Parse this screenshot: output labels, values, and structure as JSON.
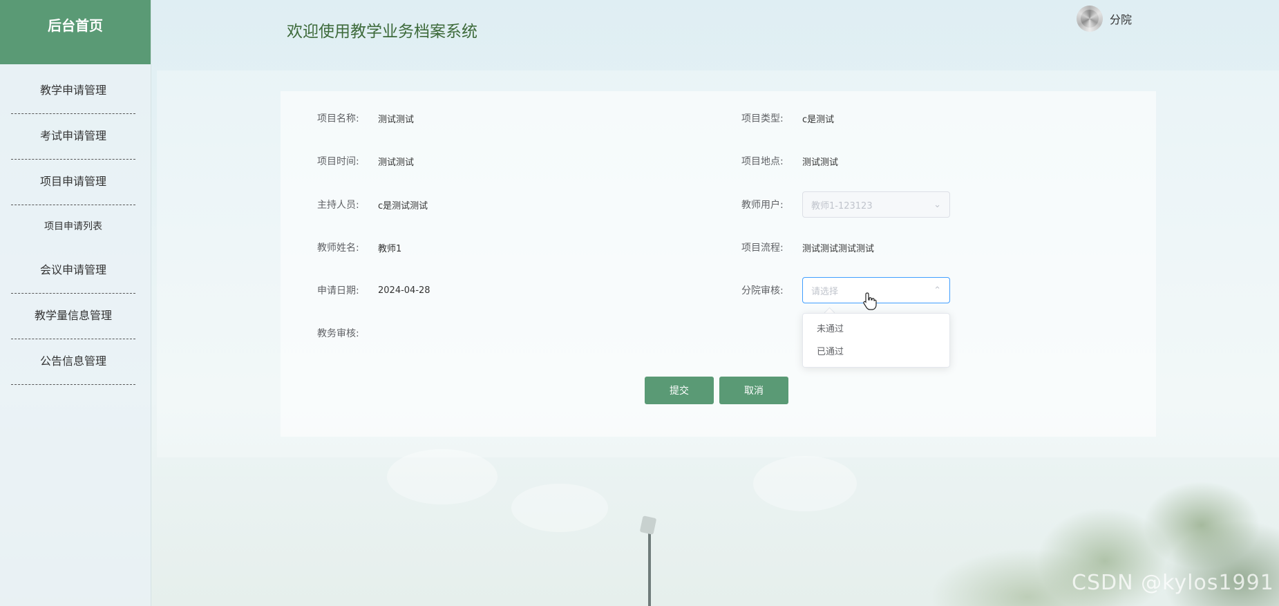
{
  "sidebar": {
    "header": "后台首页",
    "items": [
      {
        "label": "教学申请管理"
      },
      {
        "label": "考试申请管理"
      },
      {
        "label": "项目申请管理"
      },
      {
        "label": "项目申请列表"
      },
      {
        "label": "会议申请管理"
      },
      {
        "label": "教学量信息管理"
      },
      {
        "label": "公告信息管理"
      }
    ]
  },
  "header": {
    "title": "欢迎使用教学业务档案系统",
    "user_name": "分院"
  },
  "form": {
    "project_name": {
      "label": "项目名称:",
      "value": "测试测试"
    },
    "project_type": {
      "label": "项目类型:",
      "value": "c是测试"
    },
    "project_time": {
      "label": "项目时间:",
      "value": "测试测试"
    },
    "project_location": {
      "label": "项目地点:",
      "value": "测试测试"
    },
    "host": {
      "label": "主持人员:",
      "value": "c是测试测试"
    },
    "teacher_user": {
      "label": "教师用户:",
      "value": "教师1-123123"
    },
    "teacher_name": {
      "label": "教师姓名:",
      "value": "教师1"
    },
    "project_flow": {
      "label": "项目流程:",
      "value": "测试测试测试测试"
    },
    "apply_date": {
      "label": "申请日期:",
      "value": "2024-04-28"
    },
    "branch_review": {
      "label": "分院审核:",
      "placeholder": "请选择",
      "options": [
        "未通过",
        "已通过"
      ]
    },
    "academic_review": {
      "label": "教务审核:"
    }
  },
  "buttons": {
    "submit": "提交",
    "cancel": "取消"
  },
  "watermark": "CSDN @kylos1991",
  "colors": {
    "primary": "#5a9a75",
    "focus": "#409eff"
  }
}
